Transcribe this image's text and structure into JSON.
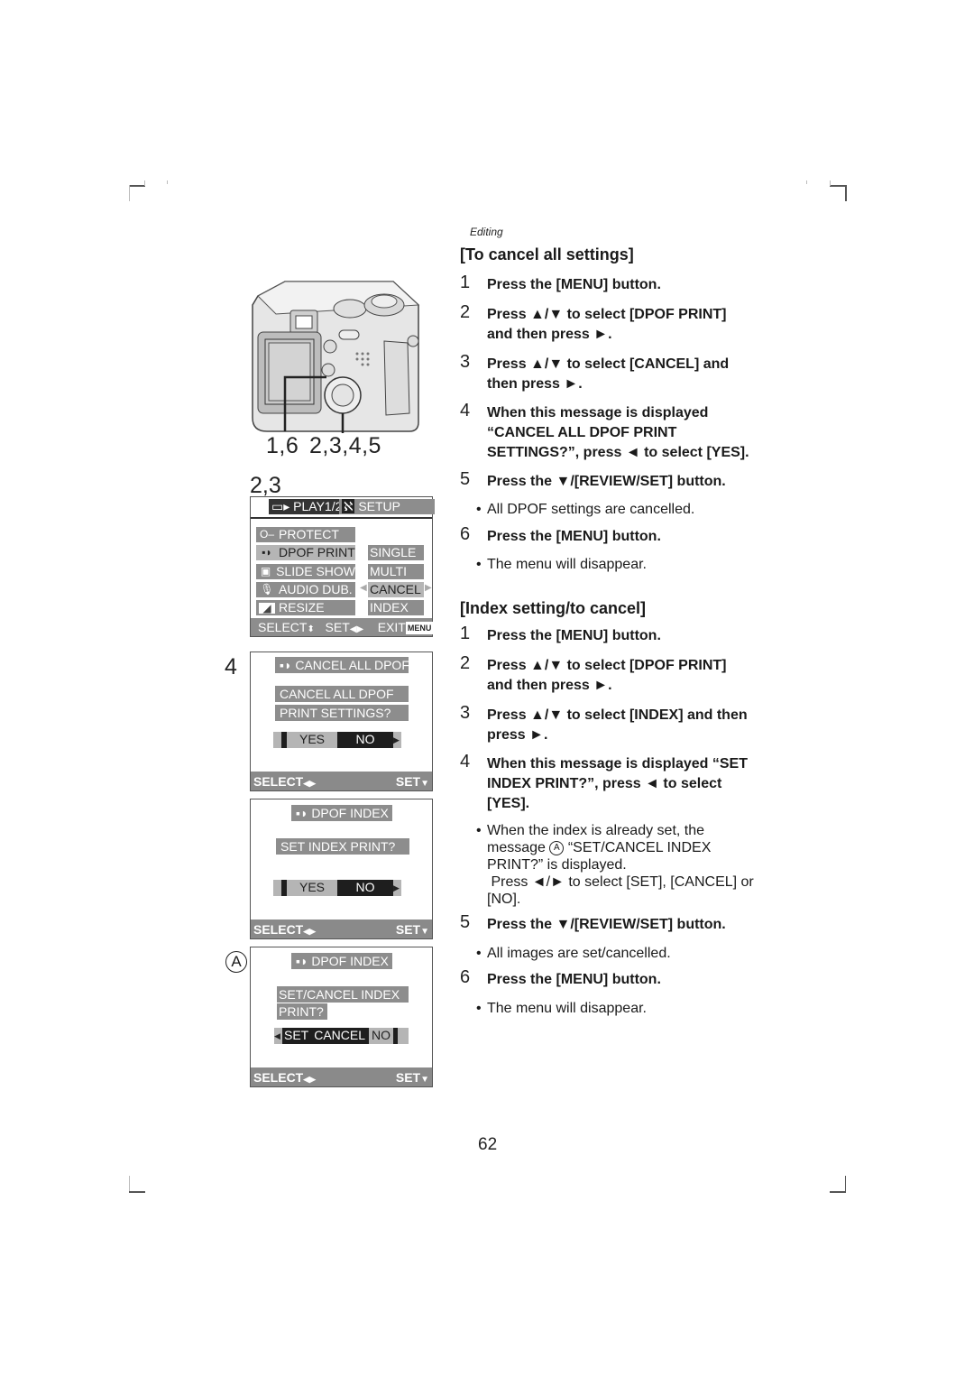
{
  "header": {
    "section": "Editing"
  },
  "figures": {
    "camera": {
      "label_left": "1,6",
      "label_right": "2,3,4,5"
    },
    "menu_screen": {
      "step_label": "2,3",
      "tabs": {
        "play": "PLAY1/2",
        "setup": "SETUP"
      },
      "items": [
        {
          "icon": "key-icon",
          "label": "PROTECT",
          "selected": false
        },
        {
          "icon": "dpof-icon",
          "label": "DPOF PRINT",
          "selected": true
        },
        {
          "icon": "slideshow-icon",
          "label": "SLIDE SHOW",
          "selected": false
        },
        {
          "icon": "microphone-icon",
          "label": "AUDIO DUB.",
          "selected": false
        },
        {
          "icon": "resize-icon",
          "label": "RESIZE",
          "selected": false
        }
      ],
      "submenu": [
        {
          "label": "SINGLE",
          "selected": false
        },
        {
          "label": "MULTI",
          "selected": false
        },
        {
          "label": "CANCEL",
          "selected": true
        },
        {
          "label": "INDEX",
          "selected": false
        }
      ],
      "footer": {
        "select": "SELECT",
        "set": "SET",
        "exit": "EXIT",
        "menu_badge": "MENU"
      }
    },
    "cancel_screen": {
      "step_label": "4",
      "title": "CANCEL ALL DPOF",
      "message_line1": "CANCEL ALL DPOF",
      "message_line2": "PRINT SETTINGS?",
      "yes": "YES",
      "no": "NO",
      "footer_select": "SELECT",
      "footer_set": "SET"
    },
    "index_screen": {
      "title": "DPOF INDEX",
      "message": "SET INDEX PRINT?",
      "yes": "YES",
      "no": "NO",
      "footer_select": "SELECT",
      "footer_set": "SET"
    },
    "index_cancel_screen": {
      "marker": "A",
      "title": "DPOF INDEX",
      "message_line1": "SET/CANCEL INDEX",
      "message_line2": "PRINT?",
      "set": "SET",
      "cancel": "CANCEL",
      "no": "NO",
      "footer_select": "SELECT",
      "footer_set": "SET"
    }
  },
  "section1": {
    "heading": "[To cancel all settings]",
    "steps": [
      {
        "n": "1",
        "text": "Press the [MENU] button."
      },
      {
        "n": "2",
        "text": "Press ▲/▼ to select [DPOF PRINT] and then press ►."
      },
      {
        "n": "3",
        "text": "Press ▲/▼ to select [CANCEL] and then press ►."
      },
      {
        "n": "4",
        "text": "When this message is displayed “CANCEL ALL DPOF PRINT SETTINGS?”, press ◄ to select [YES]."
      },
      {
        "n": "5",
        "text": "Press the ▼/[REVIEW/SET] button."
      },
      {
        "n": "6",
        "text": "Press the [MENU] button."
      }
    ],
    "bullets": {
      "after5": "All DPOF settings are cancelled.",
      "after6": "The menu will disappear."
    }
  },
  "section2": {
    "heading": "[Index setting/to cancel]",
    "steps": [
      {
        "n": "1",
        "text": "Press the [MENU] button."
      },
      {
        "n": "2",
        "text": "Press ▲/▼ to select [DPOF PRINT] and then press ►."
      },
      {
        "n": "3",
        "text": "Press ▲/▼ to select [INDEX] and then press ►."
      },
      {
        "n": "4",
        "text": "When this message is displayed “SET INDEX PRINT?”, press ◄ to select [YES]."
      },
      {
        "n": "5",
        "text": "Press the ▼/[REVIEW/SET] button."
      },
      {
        "n": "6",
        "text": "Press the [MENU] button."
      }
    ],
    "bullets": {
      "after4_pre": "When the index is already set, the message",
      "after4_marker": "A",
      "after4_post": "“SET/CANCEL INDEX PRINT?” is displayed.",
      "after4_line2": "Press ◄/► to select [SET], [CANCEL] or [NO].",
      "after5": "All images are set/cancelled.",
      "after6": "The menu will disappear."
    }
  },
  "footer": {
    "page_number": "62"
  }
}
